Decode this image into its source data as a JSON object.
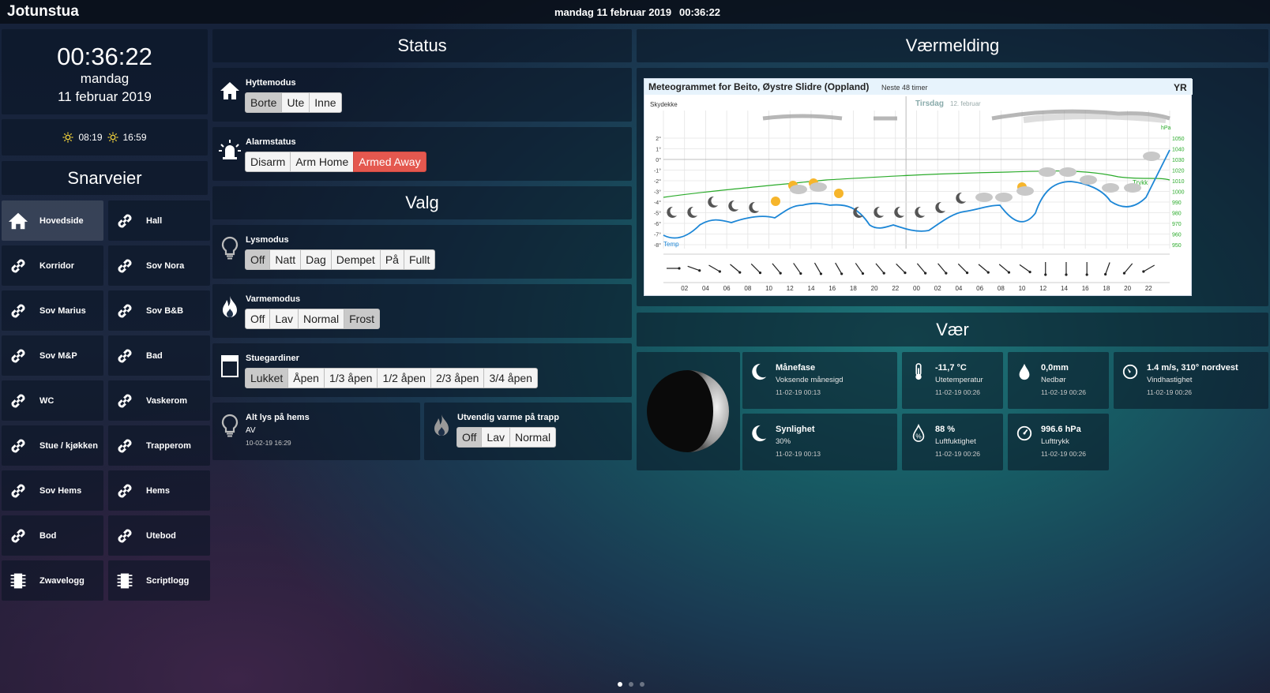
{
  "header": {
    "title": "Jotunstua",
    "date": "mandag 11 februar 2019",
    "time": "00:36:22"
  },
  "clock": {
    "time": "00:36:22",
    "weekday": "mandag",
    "date": "11 februar 2019"
  },
  "sun": {
    "sunrise": "08:19",
    "sunset": "16:59"
  },
  "sections": {
    "shortcuts": "Snarveier",
    "status": "Status",
    "options": "Valg",
    "forecast": "Værmelding",
    "weather": "Vær"
  },
  "shortcuts": [
    {
      "label": "Hovedside",
      "icon": "home-icon",
      "active": true
    },
    {
      "label": "Hall",
      "icon": "link-icon"
    },
    {
      "label": "Korridor",
      "icon": "link-icon"
    },
    {
      "label": "Sov Nora",
      "icon": "link-icon"
    },
    {
      "label": "Sov Marius",
      "icon": "link-icon"
    },
    {
      "label": "Sov B&B",
      "icon": "link-icon"
    },
    {
      "label": "Sov M&P",
      "icon": "link-icon"
    },
    {
      "label": "Bad",
      "icon": "link-icon"
    },
    {
      "label": "WC",
      "icon": "link-icon"
    },
    {
      "label": "Vaskerom",
      "icon": "link-icon"
    },
    {
      "label": "Stue / kjøkken",
      "icon": "link-icon"
    },
    {
      "label": "Trapperom",
      "icon": "link-icon"
    },
    {
      "label": "Sov Hems",
      "icon": "link-icon"
    },
    {
      "label": "Hems",
      "icon": "link-icon"
    },
    {
      "label": "Bod",
      "icon": "link-icon"
    },
    {
      "label": "Utebod",
      "icon": "link-icon"
    },
    {
      "label": "Zwavelogg",
      "icon": "chip-icon"
    },
    {
      "label": "Scriptlogg",
      "icon": "chip-icon"
    }
  ],
  "controls": {
    "hyttemodus": {
      "title": "Hyttemodus",
      "options": [
        "Borte",
        "Ute",
        "Inne"
      ],
      "selected": "Borte"
    },
    "alarm": {
      "title": "Alarmstatus",
      "options": [
        "Disarm",
        "Arm Home",
        "Armed Away"
      ],
      "selected": "Armed Away"
    },
    "lys": {
      "title": "Lysmodus",
      "options": [
        "Off",
        "Natt",
        "Dag",
        "Dempet",
        "På",
        "Fullt"
      ],
      "selected": "Off"
    },
    "varme": {
      "title": "Varmemodus",
      "options": [
        "Off",
        "Lav",
        "Normal",
        "Frost"
      ],
      "selected": "Frost"
    },
    "gardiner": {
      "title": "Stuegardiner",
      "options": [
        "Lukket",
        "Åpen",
        "1/3 åpen",
        "1/2 åpen",
        "2/3 åpen",
        "3/4 åpen"
      ],
      "selected": "Lukket"
    },
    "hems": {
      "title": "Alt lys på hems",
      "value": "AV",
      "time": "10-02-19 16:29"
    },
    "trapp": {
      "title": "Utvendig varme på trapp",
      "options": [
        "Off",
        "Lav",
        "Normal"
      ],
      "selected": "Off"
    }
  },
  "meteogram": {
    "title": "Meteogrammet for Beito, Øystre Slidre (Oppland)",
    "subtitle": "Neste 48 timer",
    "logo": "YR",
    "label_clouds": "Skydekke",
    "day2": "Tirsdag",
    "day2_date": "12. februar",
    "label_temp": "Temp",
    "label_pressure": "Trykk",
    "pressure_unit": "hPa",
    "y_temp": [
      "2°",
      "1°",
      "0°",
      "-1°",
      "-2°",
      "-3°",
      "-4°",
      "-5°",
      "-6°",
      "-7°",
      "-8°"
    ],
    "y_pres": [
      "1050",
      "1040",
      "1030",
      "1020",
      "1010",
      "1000",
      "990",
      "980",
      "970",
      "960",
      "950"
    ],
    "x_hours": [
      "02",
      "04",
      "06",
      "08",
      "10",
      "12",
      "14",
      "16",
      "18",
      "20",
      "22",
      "00",
      "02",
      "04",
      "06",
      "08",
      "10",
      "12",
      "14",
      "16",
      "18",
      "20",
      "22"
    ]
  },
  "weather": [
    {
      "value": "Månefase",
      "sub": "Voksende månesigd",
      "time": "11-02-19 00:13",
      "icon": "moon-icon"
    },
    {
      "value": "-11,7 °C",
      "sub": "Utetemperatur",
      "time": "11-02-19 00:26",
      "icon": "thermometer-icon"
    },
    {
      "value": "0,0mm",
      "sub": "Nedbør",
      "time": "11-02-19 00:26",
      "icon": "raindrop-icon"
    },
    {
      "value": "1.4 m/s, 310° nordvest",
      "sub": "Vindhastighet",
      "time": "11-02-19 00:26",
      "icon": "compass-icon"
    },
    {
      "value": "Synlighet",
      "sub": "30%",
      "time": "11-02-19 00:13",
      "icon": "moon-icon"
    },
    {
      "value": "88 %",
      "sub": "Luftfuktighet",
      "time": "11-02-19 00:26",
      "icon": "humidity-icon"
    },
    {
      "value": "996.6 hPa",
      "sub": "Lufttrykk",
      "time": "11-02-19 00:26",
      "icon": "gauge-icon"
    }
  ]
}
